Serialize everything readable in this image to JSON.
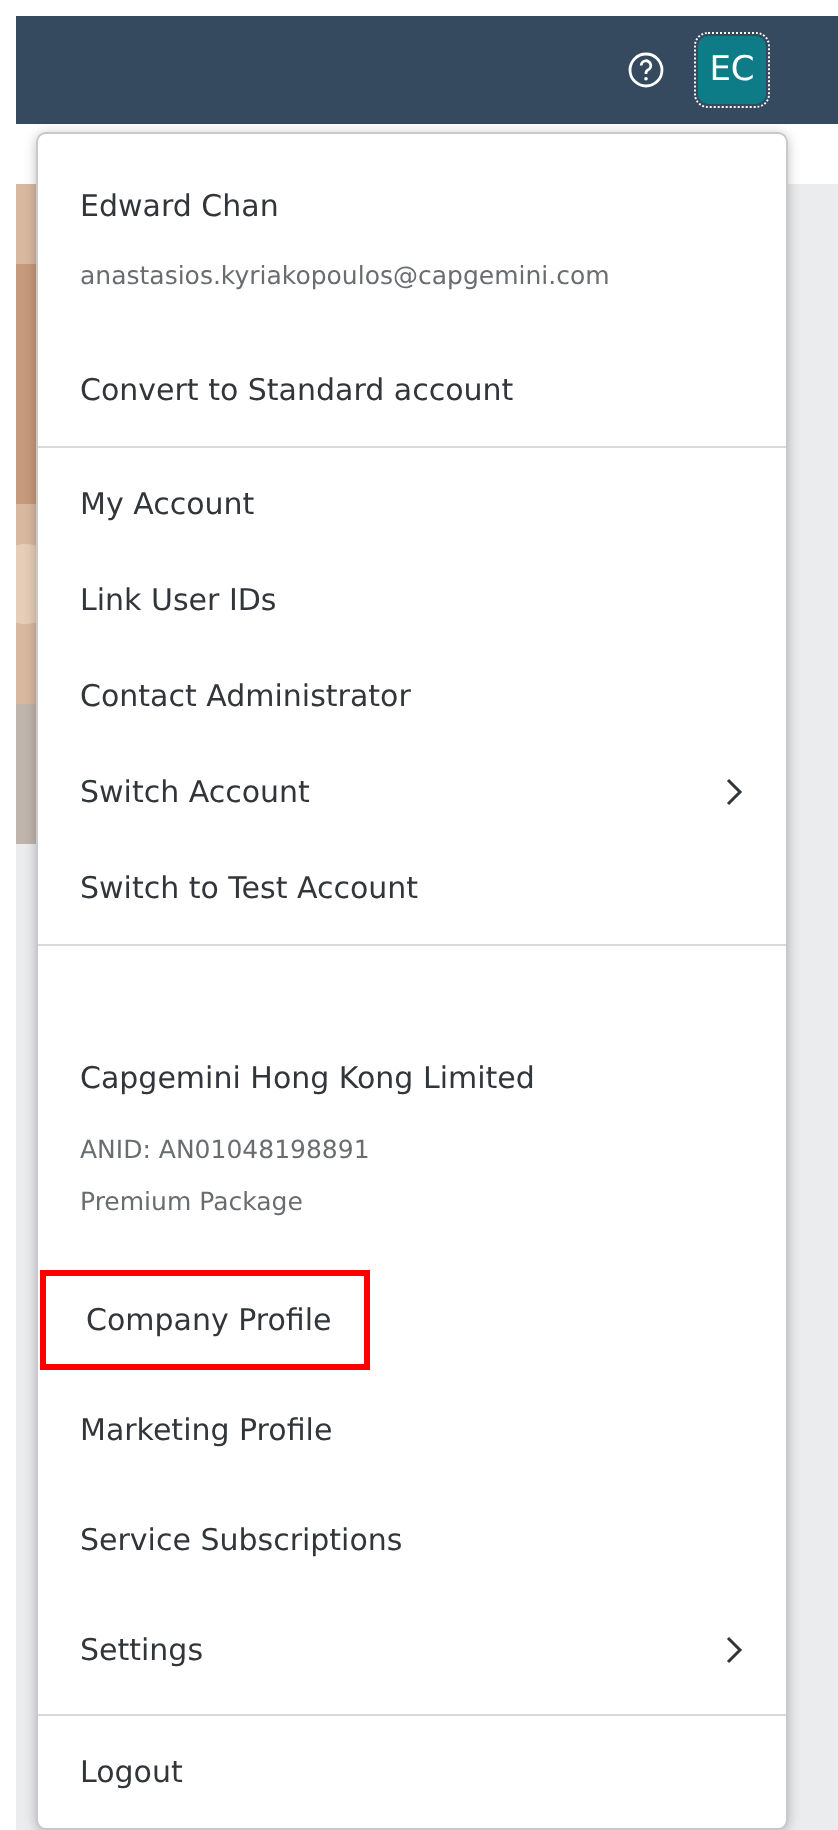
{
  "header": {
    "avatar": {
      "initials": "EC",
      "focused": true
    }
  },
  "menu": {
    "sections": [
      {
        "header": {
          "title": "Edward Chan",
          "lines": [
            "anastasios.kyriakopoulos@capgemini.com"
          ]
        },
        "items": [
          {
            "label": "Convert to Standard account",
            "submenu": false,
            "highlighted": false
          }
        ]
      },
      {
        "items": [
          {
            "label": "My Account",
            "submenu": false,
            "highlighted": false
          },
          {
            "label": "Link User IDs",
            "submenu": false,
            "highlighted": false
          },
          {
            "label": "Contact Administrator",
            "submenu": false,
            "highlighted": false
          },
          {
            "label": "Switch Account",
            "submenu": true,
            "highlighted": false
          },
          {
            "label": "Switch to Test Account",
            "submenu": false,
            "highlighted": false
          }
        ]
      },
      {
        "header": {
          "title": "Capgemini Hong Kong Limited",
          "lines": [
            "ANID: AN01048198891",
            "Premium Package"
          ]
        },
        "items": [
          {
            "label": "Company Profile",
            "submenu": false,
            "highlighted": true
          },
          {
            "label": "Marketing Profile",
            "submenu": false,
            "highlighted": false
          },
          {
            "label": "Service Subscriptions",
            "submenu": false,
            "highlighted": false
          },
          {
            "label": "Settings",
            "submenu": true,
            "highlighted": false
          }
        ]
      },
      {
        "items": [
          {
            "label": "Logout",
            "submenu": false,
            "highlighted": false
          }
        ]
      }
    ]
  }
}
